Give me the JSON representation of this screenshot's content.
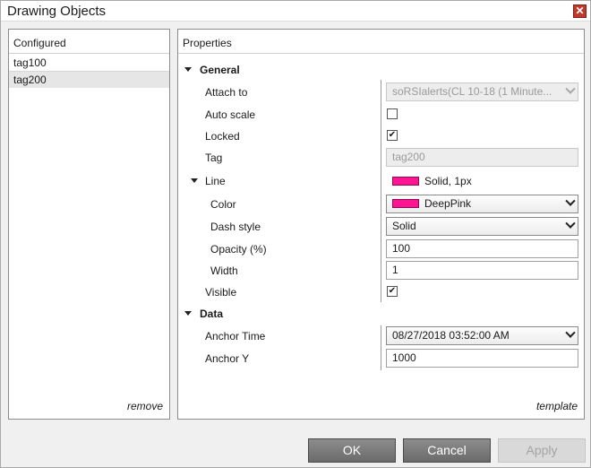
{
  "window": {
    "title": "Drawing Objects",
    "close_glyph": "✕"
  },
  "configured": {
    "header": "Configured",
    "items": [
      "tag100",
      "tag200"
    ],
    "selected_index": 1,
    "remove_label": "remove"
  },
  "properties": {
    "header": "Properties",
    "template_label": "template",
    "general": {
      "label": "General",
      "attach_to": {
        "label": "Attach to",
        "value": "soRSIalerts(CL 10-18 (1 Minute..."
      },
      "auto_scale": {
        "label": "Auto scale",
        "checked": false
      },
      "locked": {
        "label": "Locked",
        "checked": true
      },
      "tag": {
        "label": "Tag",
        "placeholder": "tag200"
      },
      "line": {
        "label": "Line",
        "summary": "Solid, 1px",
        "color": {
          "label": "Color",
          "value": "DeepPink",
          "hex": "#ff1493"
        },
        "dash_style": {
          "label": "Dash style",
          "value": "Solid"
        },
        "opacity": {
          "label": "Opacity (%)",
          "value": "100"
        },
        "width": {
          "label": "Width",
          "value": "1"
        }
      },
      "visible": {
        "label": "Visible",
        "checked": true
      }
    },
    "data": {
      "label": "Data",
      "anchor_time": {
        "label": "Anchor Time",
        "value": "08/27/2018 03:52:00 AM"
      },
      "anchor_y": {
        "label": "Anchor Y",
        "value": "1000"
      }
    }
  },
  "buttons": {
    "ok": "OK",
    "cancel": "Cancel",
    "apply": "Apply"
  },
  "check_glyph": "✔"
}
